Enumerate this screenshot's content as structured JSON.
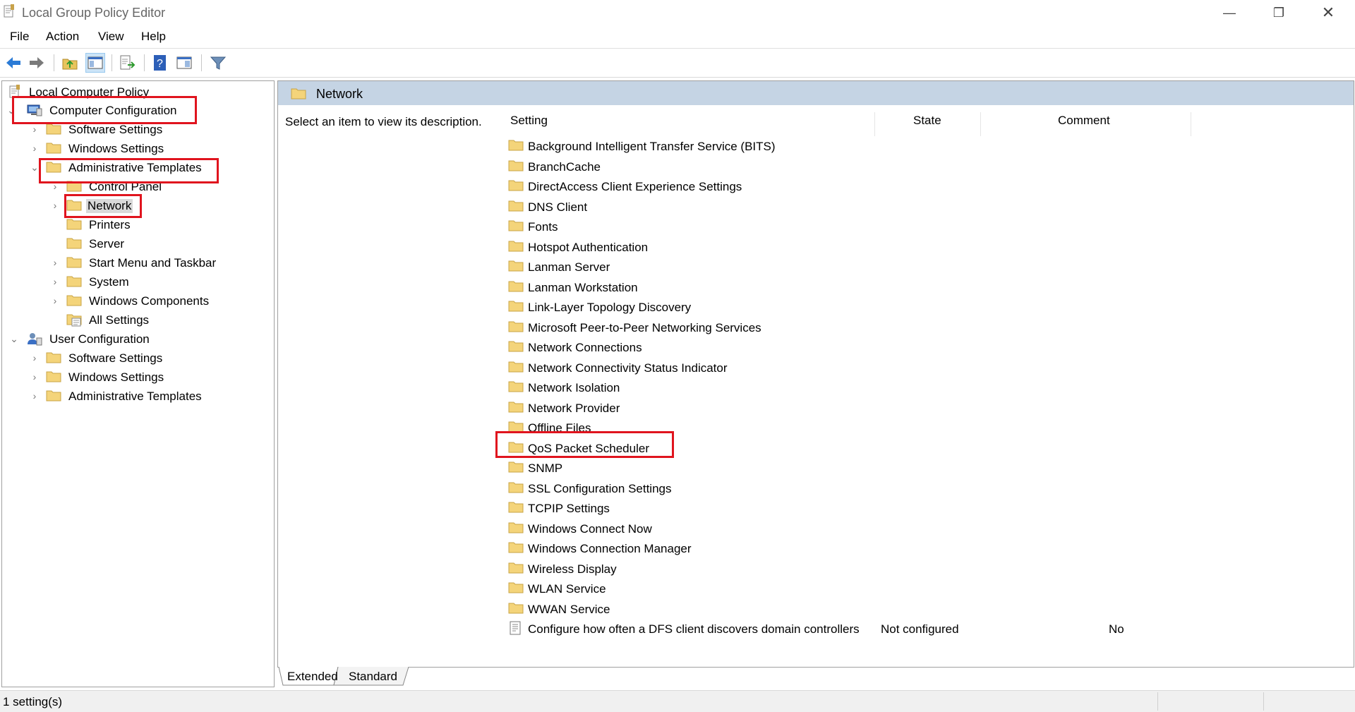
{
  "window": {
    "title": "Local Group Policy Editor",
    "minimize_glyph": "—",
    "maximize_glyph": "❐",
    "close_glyph": "✕"
  },
  "menu": [
    "File",
    "Action",
    "View",
    "Help"
  ],
  "toolbar_icons": [
    "back-arrow-icon",
    "forward-arrow-icon",
    "up-folder-icon",
    "show-hide-console-tree-icon",
    "export-list-icon",
    "help-icon",
    "properties-icon",
    "filter-icon"
  ],
  "tree": {
    "root": "Local Computer Policy",
    "computer_configuration": "Computer Configuration",
    "cc_software_settings": "Software Settings",
    "cc_windows_settings": "Windows Settings",
    "cc_admin_templates": "Administrative Templates",
    "control_panel": "Control Panel",
    "network": "Network",
    "printers": "Printers",
    "server": "Server",
    "start_menu": "Start Menu and Taskbar",
    "system": "System",
    "windows_components": "Windows Components",
    "all_settings": "All Settings",
    "user_configuration": "User Configuration",
    "uc_software_settings": "Software Settings",
    "uc_windows_settings": "Windows Settings",
    "uc_admin_templates": "Administrative Templates"
  },
  "right_pane": {
    "header_title": "Network",
    "description": "Select an item to view its description.",
    "columns": {
      "setting": "Setting",
      "state": "State",
      "comment": "Comment"
    },
    "folders": [
      "Background Intelligent Transfer Service (BITS)",
      "BranchCache",
      "DirectAccess Client Experience Settings",
      "DNS Client",
      "Fonts",
      "Hotspot Authentication",
      "Lanman Server",
      "Lanman Workstation",
      "Link-Layer Topology Discovery",
      "Microsoft Peer-to-Peer Networking Services",
      "Network Connections",
      "Network Connectivity Status Indicator",
      "Network Isolation",
      "Network Provider",
      "Offline Files",
      "QoS Packet Scheduler",
      "SNMP",
      "SSL Configuration Settings",
      "TCPIP Settings",
      "Windows Connect Now",
      "Windows Connection Manager",
      "Wireless Display",
      "WLAN Service",
      "WWAN Service"
    ],
    "policy": {
      "name": "Configure how often a DFS client discovers domain controllers",
      "state": "Not configured",
      "comment": "No"
    }
  },
  "tabs": [
    "Extended",
    "Standard"
  ],
  "status": "1 setting(s)",
  "colors": {
    "highlight": "#e0141e",
    "header": "#c5d4e4",
    "folder": "#f4d47a"
  }
}
